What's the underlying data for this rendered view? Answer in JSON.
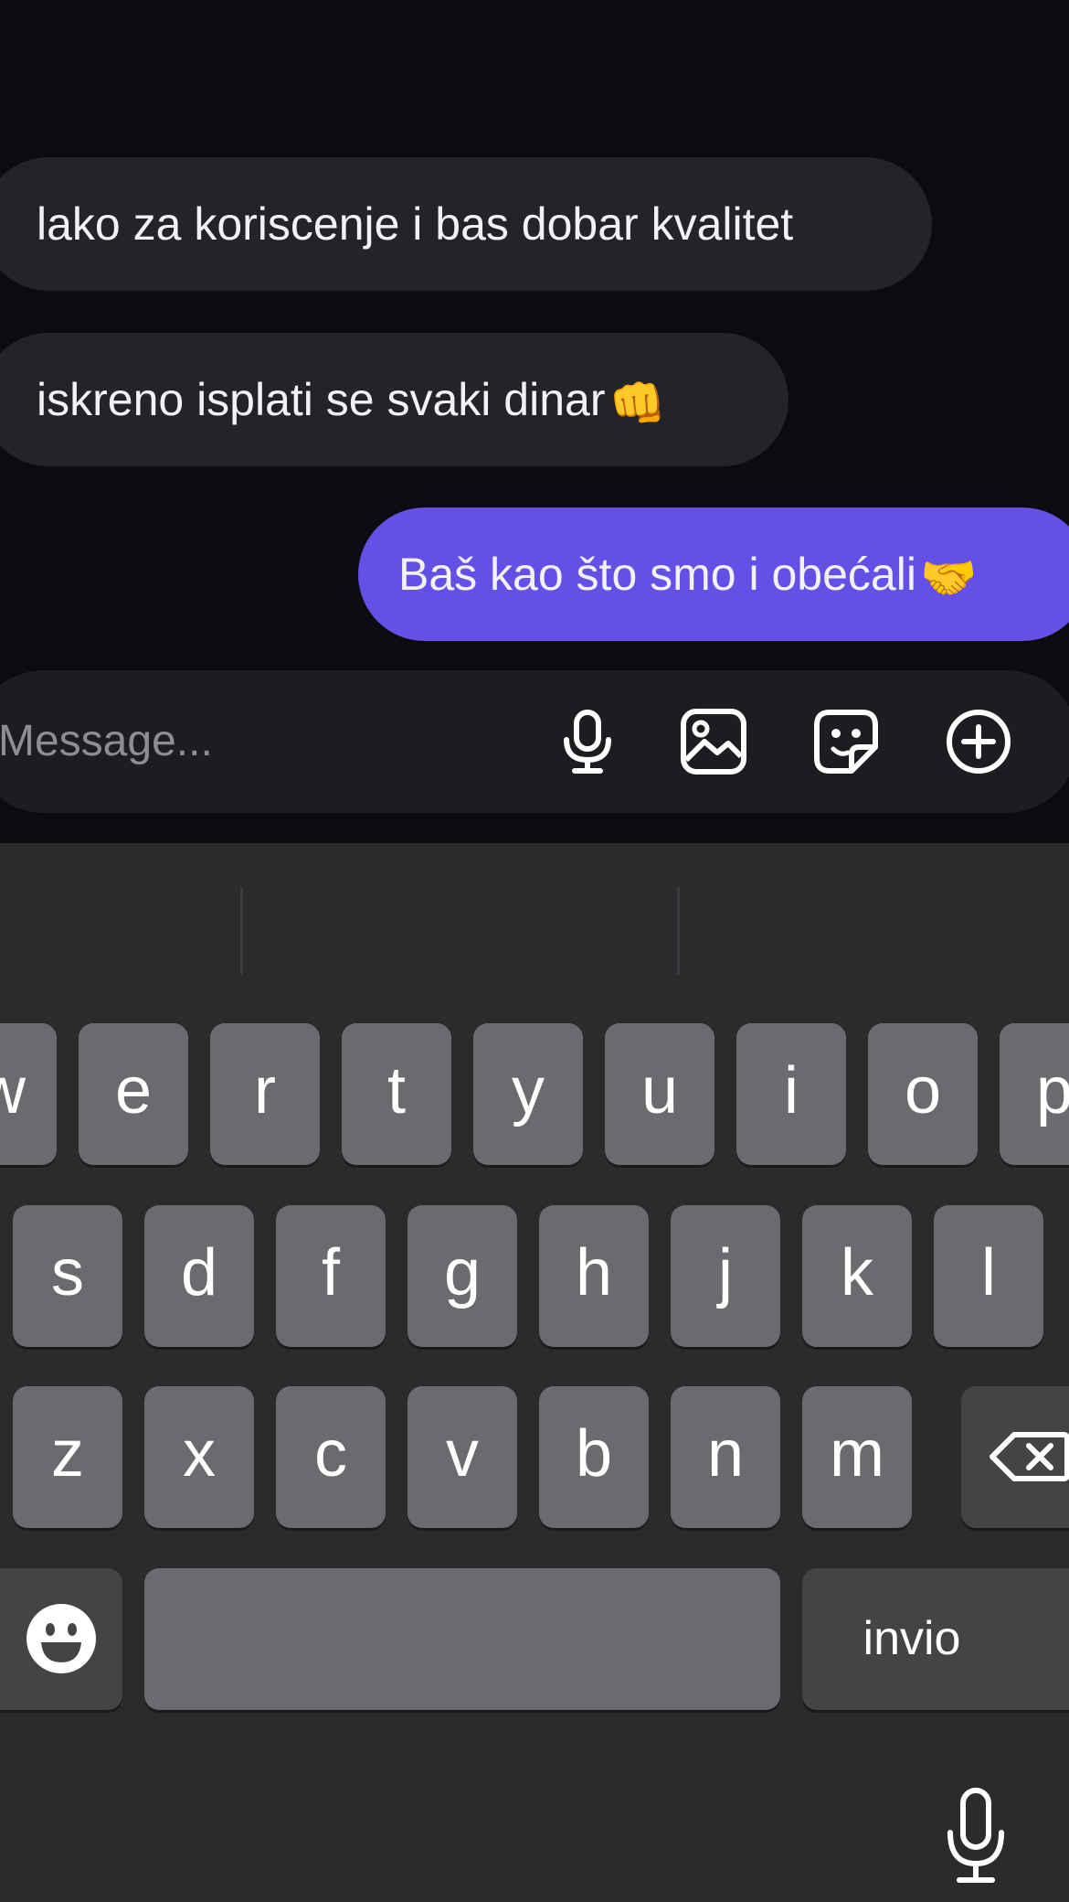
{
  "messages": [
    {
      "direction": "incoming",
      "text": "lako za koriscenje i bas dobar kvalitet",
      "emoji": ""
    },
    {
      "direction": "incoming",
      "text": "iskreno isplati se svaki dinar",
      "emoji": "👊"
    },
    {
      "direction": "outgoing",
      "text": "Baš kao što smo i obećali",
      "emoji": "🤝"
    }
  ],
  "composer": {
    "placeholder": "Message...",
    "icons": [
      "microphone-icon",
      "image-icon",
      "sticker-icon",
      "add-icon"
    ]
  },
  "keyboard": {
    "row1": [
      "w",
      "e",
      "r",
      "t",
      "y",
      "u",
      "i",
      "o",
      "p"
    ],
    "row2": [
      "s",
      "d",
      "f",
      "g",
      "h",
      "j",
      "k",
      "l"
    ],
    "row3": [
      "z",
      "x",
      "c",
      "v",
      "b",
      "n",
      "m"
    ],
    "return_label": "invio",
    "icons": [
      "backspace-icon",
      "emoji-icon",
      "dictation-icon"
    ]
  },
  "colors": {
    "outgoing_bubble": "#6450e6",
    "incoming_bubble": "#232329",
    "background": "#0c0c10",
    "keyboard_bg": "#2b2b2e",
    "key": "#6b6b6f"
  }
}
